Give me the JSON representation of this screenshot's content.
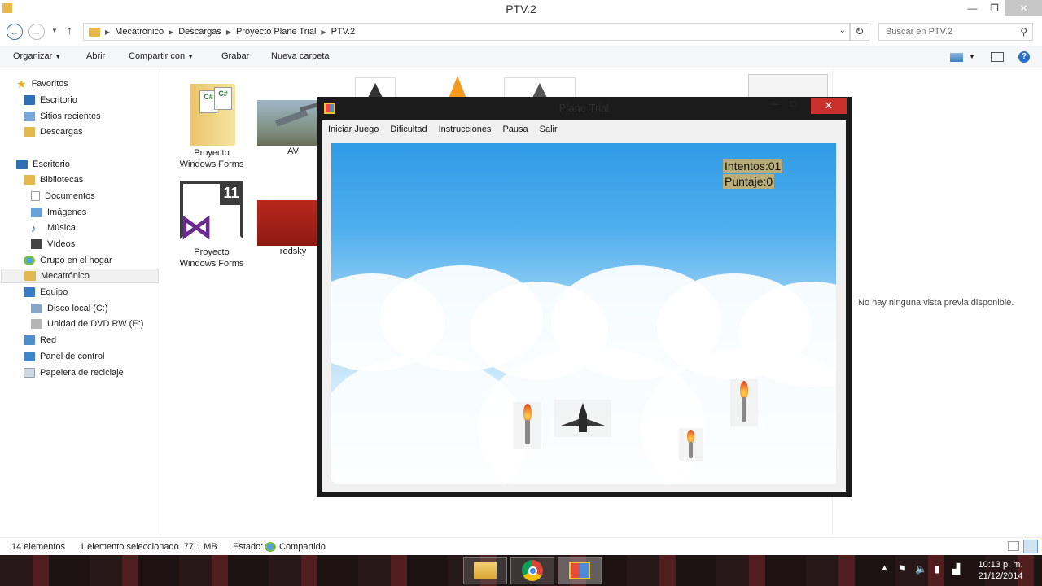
{
  "window": {
    "title": "PTV.2",
    "buttons": {
      "minimize": "—",
      "maximize": "❐",
      "close": "✕"
    }
  },
  "address": {
    "crumbs": [
      "Mecatrónico",
      "Descargas",
      "Proyecto Plane Trial",
      "PTV.2"
    ],
    "search_placeholder": "Buscar en PTV.2"
  },
  "toolbar": {
    "organize": "Organizar",
    "open": "Abrir",
    "share": "Compartir con",
    "burn": "Grabar",
    "new_folder": "Nueva carpeta"
  },
  "nav": {
    "favorites": "Favoritos",
    "fav_items": [
      "Escritorio",
      "Sitios recientes",
      "Descargas"
    ],
    "desktop": "Escritorio",
    "libraries": "Bibliotecas",
    "lib_items": [
      "Documentos",
      "Imágenes",
      "Música",
      "Vídeos"
    ],
    "homegroup": "Grupo en el hogar",
    "user": "Mecatrónico",
    "computer": "Equipo",
    "drives": [
      "Disco local (C:)",
      "Unidad de DVD RW (E:)"
    ],
    "network": "Red",
    "control_panel": "Panel de control",
    "recycle_bin": "Papelera de reciclaje"
  },
  "files": [
    {
      "name": "Proyecto\nWindows Forms"
    },
    {
      "name": "AV"
    },
    {
      "name": "Proyecto\nWindows Forms"
    },
    {
      "name": "redsky"
    }
  ],
  "preview": {
    "empty_text": "No hay ninguna vista previa disponible."
  },
  "status": {
    "count": "14 elementos",
    "selected": "1 elemento seleccionado  77.1 MB",
    "state_label": "Estado:",
    "state_value": "Compartido"
  },
  "game": {
    "title": "Plane Trial",
    "menu": [
      "Iniciar Juego",
      "Dificultad",
      "Instrucciones",
      "Pausa",
      "Salir"
    ],
    "attempts": "Intentos:01",
    "score": "Puntaje:0",
    "close": "✕"
  },
  "taskbar": {
    "time": "10:13 p. m.",
    "date": "21/12/2014"
  },
  "colors": {
    "accent": "#3a6ea5",
    "close_red": "#c9302c",
    "sky_top": "#2f9be6",
    "score_bg": "#b9ae7a"
  }
}
